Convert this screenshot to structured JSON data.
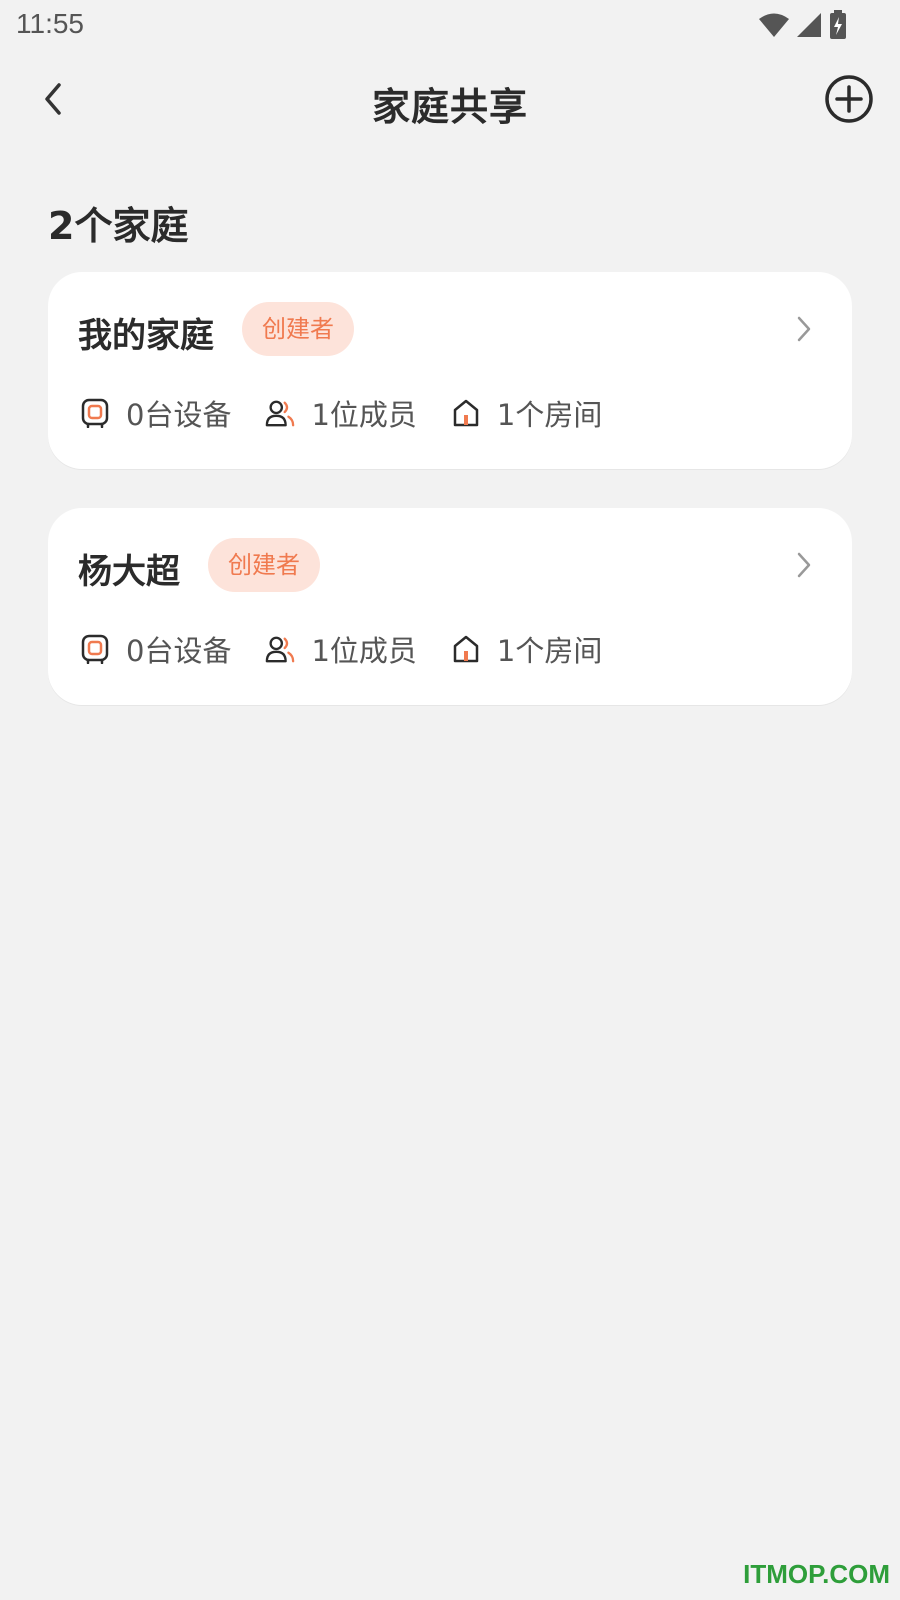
{
  "status_bar": {
    "time": "11:55"
  },
  "header": {
    "title": "家庭共享"
  },
  "section": {
    "title": "2个家庭"
  },
  "homes": [
    {
      "name": "我的家庭",
      "role": "创建者",
      "devices": "0台设备",
      "members": "1位成员",
      "rooms": "1个房间"
    },
    {
      "name": "杨大超",
      "role": "创建者",
      "devices": "0台设备",
      "members": "1位成员",
      "rooms": "1个房间"
    }
  ],
  "colors": {
    "accent": "#f07a4f",
    "badge_bg": "#fde3da",
    "background": "#f2f2f2",
    "card": "#ffffff"
  },
  "watermark": "ITMOP.COM"
}
